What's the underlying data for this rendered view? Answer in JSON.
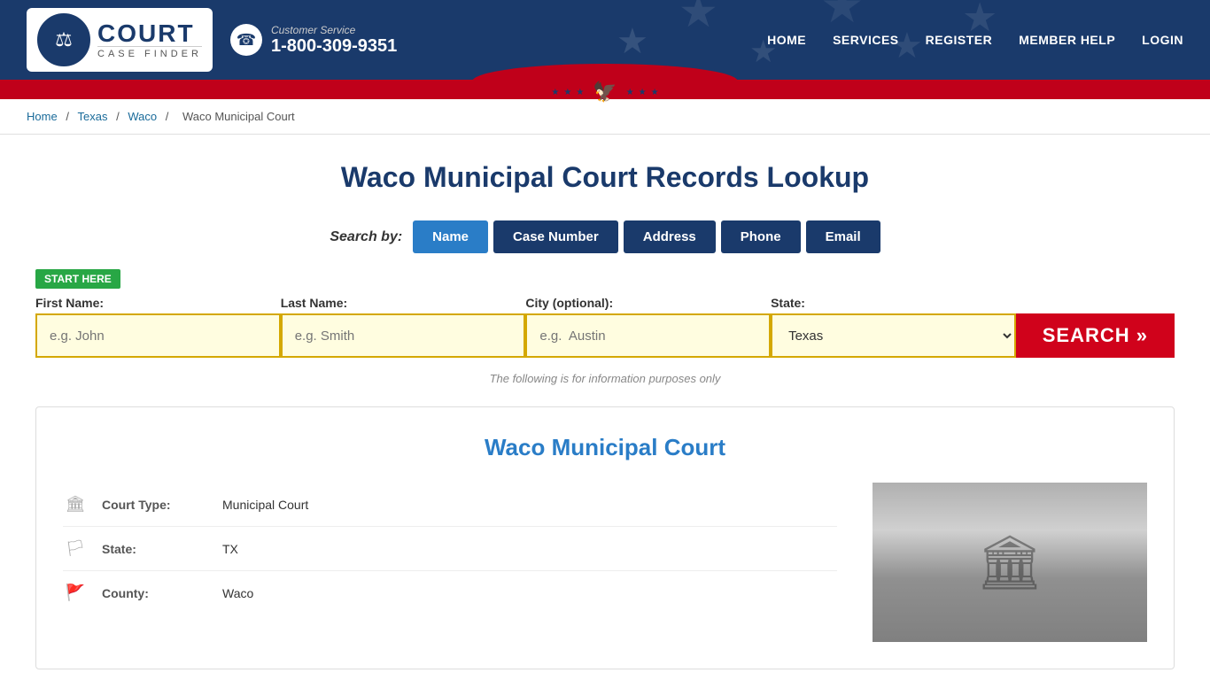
{
  "header": {
    "logo_court": "COURT",
    "logo_case_finder": "CASE FINDER",
    "cs_label": "Customer Service",
    "cs_number": "1-800-309-9351",
    "nav": [
      {
        "label": "HOME",
        "key": "home"
      },
      {
        "label": "SERVICES",
        "key": "services"
      },
      {
        "label": "REGISTER",
        "key": "register"
      },
      {
        "label": "MEMBER HELP",
        "key": "member-help"
      },
      {
        "label": "LOGIN",
        "key": "login"
      }
    ]
  },
  "breadcrumb": {
    "home": "Home",
    "state": "Texas",
    "city": "Waco",
    "court": "Waco Municipal Court"
  },
  "page": {
    "title": "Waco Municipal Court Records Lookup",
    "search_by_label": "Search by:",
    "tabs": [
      {
        "label": "Name",
        "active": true
      },
      {
        "label": "Case Number",
        "active": false
      },
      {
        "label": "Address",
        "active": false
      },
      {
        "label": "Phone",
        "active": false
      },
      {
        "label": "Email",
        "active": false
      }
    ],
    "start_here": "START HERE",
    "form": {
      "first_name_label": "First Name:",
      "first_name_placeholder": "e.g. John",
      "last_name_label": "Last Name:",
      "last_name_placeholder": "e.g. Smith",
      "city_label": "City (optional):",
      "city_placeholder": "e.g.  Austin",
      "state_label": "State:",
      "state_value": "Texas",
      "search_button": "SEARCH »"
    },
    "info_text": "The following is for information purposes only"
  },
  "court": {
    "title": "Waco Municipal Court",
    "type_label": "Court Type:",
    "type_value": "Municipal Court",
    "state_label": "State:",
    "state_value": "TX",
    "county_label": "County:",
    "county_value": "Waco"
  }
}
